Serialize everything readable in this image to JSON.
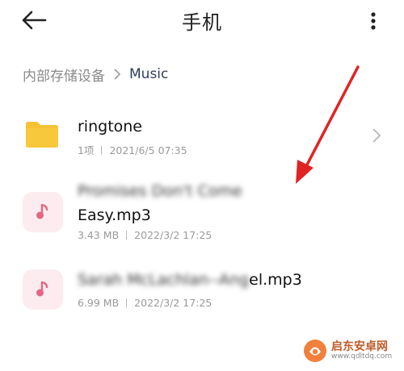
{
  "header": {
    "title": "手机",
    "back_icon": "arrow-left-icon",
    "more_icon": "vertical-dots-icon"
  },
  "breadcrumb": {
    "root": "内部存储设备",
    "current": "Music"
  },
  "files": [
    {
      "name": "ringtone",
      "count": "1项",
      "date": "2021/6/5 07:35",
      "icon": "folder-icon"
    },
    {
      "name_blurred": "Promises Don't Come",
      "name": "Easy.mp3",
      "size": "3.43 MB",
      "date": "2022/3/2 17:25",
      "icon": "music-note-icon"
    },
    {
      "name_blurred": "Sarah McLachlan--Ang",
      "name_suffix": "el.mp3",
      "size": "6.99 MB",
      "date": "2022/3/2 17:25",
      "icon": "music-note-icon"
    }
  ],
  "watermark": {
    "brand": "启东安卓网",
    "url": "www.qdltdq.com"
  },
  "colors": {
    "accent_arrow": "#e02424",
    "folder": "#f6c234",
    "music_tile": "#fcecef",
    "music_note": "#e36784"
  }
}
